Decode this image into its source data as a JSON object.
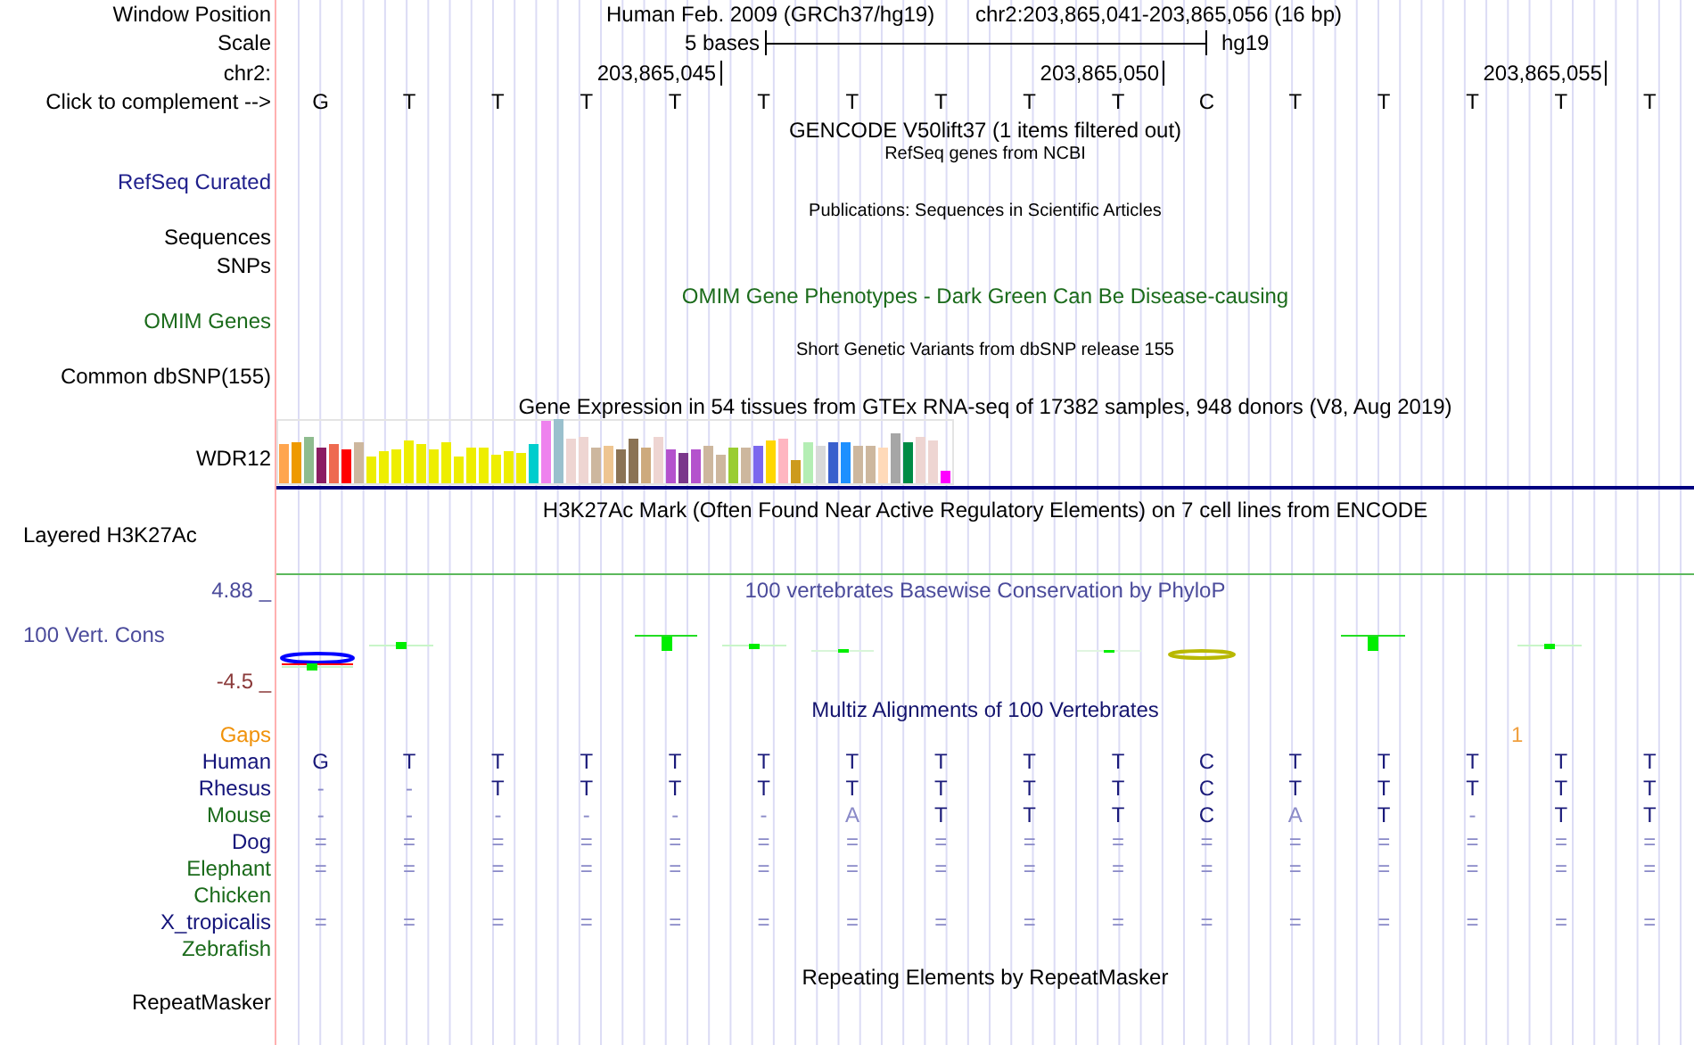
{
  "header": {
    "window_position_label": "Window Position",
    "assembly": "Human Feb. 2009 (GRCh37/hg19)",
    "position": "chr2:203,865,041-203,865,056 (16 bp)",
    "scale_label": "Scale",
    "scale_text": "5 bases",
    "scale_assembly": "hg19",
    "chrom_label": "chr2:",
    "ticks": [
      "203,865,045",
      "203,865,050",
      "203,865,055"
    ],
    "complement_label": "Click to complement -->",
    "bases": [
      "G",
      "T",
      "T",
      "T",
      "T",
      "T",
      "T",
      "T",
      "T",
      "T",
      "C",
      "T",
      "T",
      "T",
      "T",
      "T"
    ]
  },
  "track_titles": [
    {
      "text": "GENCODE V50lift37 (1 items filtered out)",
      "kind": "title",
      "color": "#000000"
    },
    {
      "text": "RefSeq genes from NCBI",
      "kind": "subtitle",
      "color": "#000000"
    },
    {
      "text": "Publications: Sequences in Scientific Articles",
      "kind": "subtitle",
      "color": "#000000"
    },
    {
      "text": "OMIM Gene Phenotypes - Dark Green Can Be Disease-causing",
      "kind": "title",
      "color": "#1b6b1b"
    },
    {
      "text": "Short Genetic Variants from dbSNP release 155",
      "kind": "subtitle",
      "color": "#000000"
    },
    {
      "text": "Gene Expression in 54 tissues from GTEx RNA-seq of 17382 samples, 948 donors (V8, Aug 2019)",
      "kind": "title",
      "color": "#000000"
    },
    {
      "text": "H3K27Ac Mark (Often Found Near Active Regulatory Elements) on 7 cell lines from ENCODE",
      "kind": "title",
      "color": "#000000"
    },
    {
      "text": "100 vertebrates Basewise Conservation by PhyloP",
      "kind": "title",
      "color": "#4b4b9b"
    },
    {
      "text": "Multiz Alignments of 100 Vertebrates",
      "kind": "title",
      "color": "#14146e"
    },
    {
      "text": "Repeating Elements by RepeatMasker",
      "kind": "title",
      "color": "#000000"
    }
  ],
  "track_labels": [
    {
      "text": "RefSeq Curated",
      "kind": "track",
      "color": "#20208c"
    },
    {
      "text": "Sequences",
      "kind": "track",
      "color": "#000000"
    },
    {
      "text": "SNPs",
      "kind": "track",
      "color": "#000000"
    },
    {
      "text": "OMIM Genes",
      "kind": "track",
      "color": "#1b6b1b"
    },
    {
      "text": "Common dbSNP(155)",
      "kind": "track",
      "color": "#000000"
    },
    {
      "text": "WDR12",
      "kind": "track",
      "color": "#000000"
    },
    {
      "text": "Layered H3K27Ac",
      "kind": "composite",
      "color": "#000000"
    }
  ],
  "conservation": {
    "label": "100 Vert. Cons",
    "max_label": "4.88 _",
    "min_label": "-4.5 _"
  },
  "alignment": {
    "gaps_label": "Gaps",
    "gap_count": "1",
    "species": [
      {
        "name": "Human",
        "color": "#14147a",
        "bases": [
          "G",
          "T",
          "T",
          "T",
          "T",
          "T",
          "T",
          "T",
          "T",
          "T",
          "C",
          "T",
          "T",
          "T",
          "T",
          "T"
        ]
      },
      {
        "name": "Rhesus",
        "color": "#14147a",
        "bases": [
          "-",
          "-",
          "T",
          "T",
          "T",
          "T",
          "T",
          "T",
          "T",
          "T",
          "C",
          "T",
          "T",
          "T",
          "T",
          "T"
        ]
      },
      {
        "name": "Mouse",
        "color": "#1b6b1b",
        "bases": [
          "-",
          "-",
          "-",
          "-",
          "-",
          "-",
          "A",
          "T",
          "T",
          "T",
          "C",
          "A",
          "T",
          "-",
          "T",
          "T"
        ]
      },
      {
        "name": "Dog",
        "color": "#14147a",
        "bases": [
          "=",
          "=",
          "=",
          "=",
          "=",
          "=",
          "=",
          "=",
          "=",
          "=",
          "=",
          "=",
          "=",
          "=",
          "=",
          "="
        ]
      },
      {
        "name": "Elephant",
        "color": "#1b6b1b",
        "bases": [
          "=",
          "=",
          "=",
          "=",
          "=",
          "=",
          "=",
          "=",
          "=",
          "=",
          "=",
          "=",
          "=",
          "=",
          "=",
          "="
        ]
      },
      {
        "name": "Chicken",
        "color": "#1b6b1b"
      },
      {
        "name": "X_tropicalis",
        "color": "#14147a",
        "bases": [
          "=",
          "=",
          "=",
          "=",
          "=",
          "=",
          "=",
          "=",
          "=",
          "=",
          "=",
          "=",
          "=",
          "=",
          "=",
          "="
        ]
      },
      {
        "name": "Zebrafish",
        "color": "#1b6b1b"
      }
    ]
  },
  "repeatmasker_label": "RepeatMasker"
}
